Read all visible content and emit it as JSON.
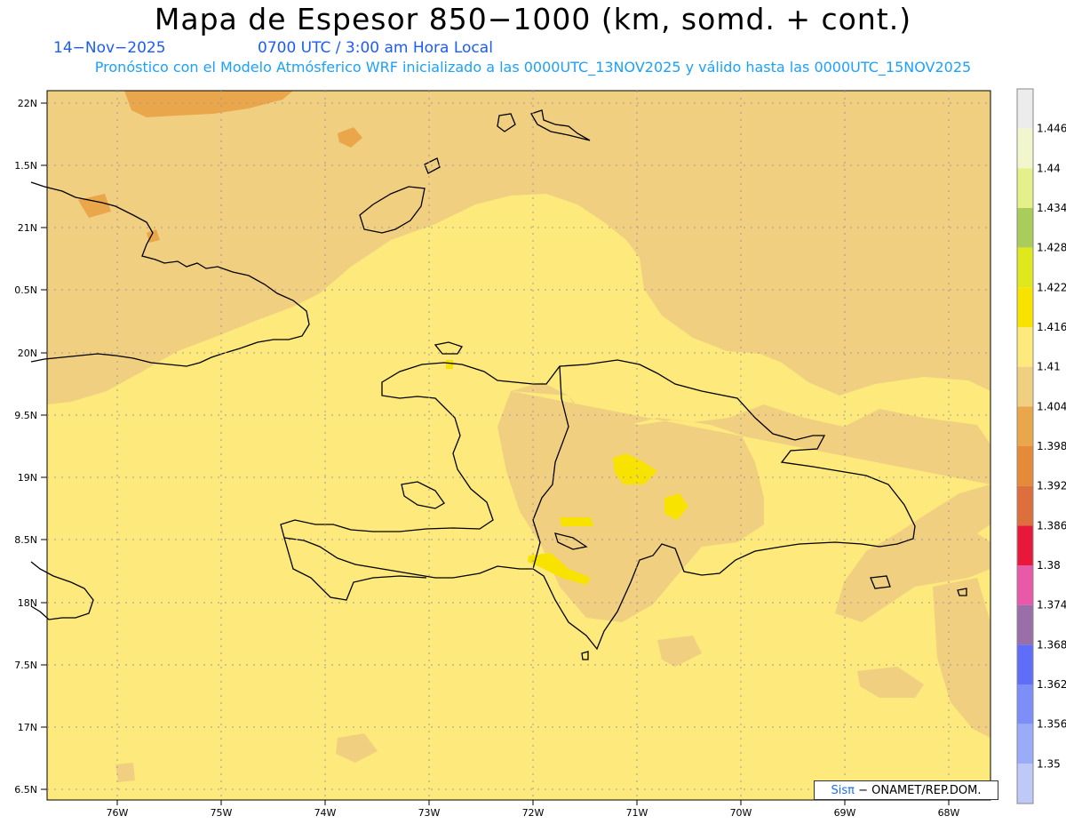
{
  "header": {
    "title": "Mapa de Espesor 850−1000 (km, somd. + cont.)",
    "date": "14−Nov−2025",
    "time": "0700 UTC / 3:00 am Hora Local",
    "description": "Pronóstico con el Modelo Atmósferico WRF inicializado a las 0000UTC_13NOV2025 y válido hasta las  0000UTC_15NOV2025"
  },
  "map": {
    "lon_labels": [
      "76W",
      "75W",
      "74W",
      "73W",
      "72W",
      "71W",
      "70W",
      "69W",
      "68W"
    ],
    "lat_labels": [
      "22N",
      "1.5N",
      "21N",
      "0.5N",
      "20N",
      "9.5N",
      "19N",
      "8.5N",
      "18N",
      "7.5N",
      "17N",
      "6.5N"
    ]
  },
  "colorbar": {
    "levels": [
      {
        "label": "1.446",
        "color": "#ececec"
      },
      {
        "label": "1.44",
        "color": "#f2f6cc"
      },
      {
        "label": "1.434",
        "color": "#e4f08a"
      },
      {
        "label": "1.428",
        "color": "#a9cc5a"
      },
      {
        "label": "1.422",
        "color": "#dfe81c"
      },
      {
        "label": "1.416",
        "color": "#f8e300"
      },
      {
        "label": "1.41",
        "color": "#fde97c"
      },
      {
        "label": "1.404",
        "color": "#f1cf80"
      },
      {
        "label": "1.398",
        "color": "#e9a64a"
      },
      {
        "label": "1.392",
        "color": "#e48a38"
      },
      {
        "label": "1.386",
        "color": "#dc6f3c"
      },
      {
        "label": "1.38",
        "color": "#e8183a"
      },
      {
        "label": "1.374",
        "color": "#e85aa8"
      },
      {
        "label": "1.368",
        "color": "#9a6ea8"
      },
      {
        "label": "1.362",
        "color": "#5f6ef8"
      },
      {
        "label": "1.356",
        "color": "#7e8ef8"
      },
      {
        "label": "1.35",
        "color": "#9aacf8"
      },
      {
        "label": "",
        "color": "#bfc9f8"
      }
    ]
  },
  "credit": {
    "sis": "Sis",
    "pi": "π",
    "rest": "− ONAMET/REP.DOM."
  },
  "colors": {
    "sea_yellow": "#fde97c",
    "tan": "#f1cf80",
    "orange": "#e9a64a",
    "bright_yellow": "#f8e300"
  }
}
